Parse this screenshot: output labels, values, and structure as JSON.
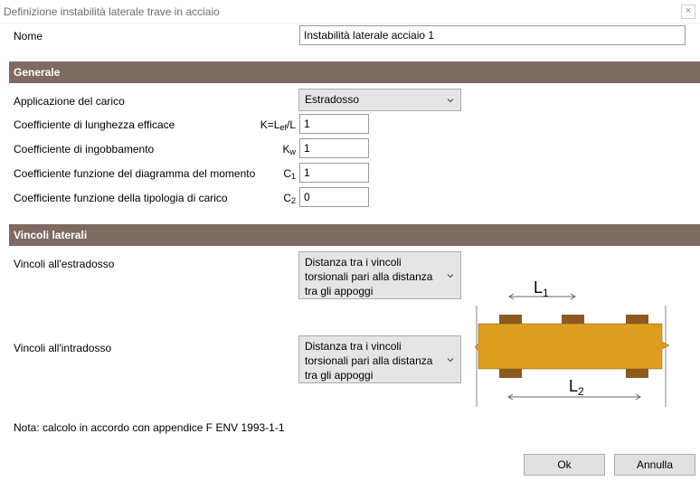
{
  "window": {
    "title": "Definizione instabilità laterale trave in acciaio",
    "close_glyph": "×"
  },
  "name_row": {
    "label": "Nome",
    "value": "Instabilità laterale acciaio 1"
  },
  "sections": {
    "general": "Generale",
    "lateral": "Vincoli laterali"
  },
  "general": {
    "load_application": {
      "label": "Applicazione del carico",
      "value": "Estradosso"
    },
    "k": {
      "label": "Coefficiente di lunghezza efficace",
      "symbol_main": "K=L",
      "symbol_sub": "ef",
      "symbol_tail": "/L",
      "value": "1"
    },
    "kw": {
      "label": "Coefficiente di ingobbamento",
      "symbol_main": "K",
      "symbol_sub": "w",
      "value": "1"
    },
    "c1": {
      "label": "Coefficiente funzione del diagramma del momento",
      "symbol_main": "C",
      "symbol_sub": "1",
      "value": "1"
    },
    "c2": {
      "label": "Coefficiente funzione della tipologia di carico",
      "symbol_main": "C",
      "symbol_sub": "2",
      "value": "0"
    }
  },
  "lateral": {
    "top": {
      "label": "Vincoli all'estradosso",
      "value_lines": [
        "Distanza tra i vincoli",
        "torsionali pari alla distanza",
        "tra gli appoggi"
      ]
    },
    "bottom": {
      "label": "Vincoli all'intradosso",
      "value_lines": [
        "Distanza tra i vincoli",
        "torsionali pari alla distanza",
        "tra gli appoggi"
      ]
    }
  },
  "diagram": {
    "l1_main": "L",
    "l1_sub": "1",
    "l2_main": "L",
    "l2_sub": "2",
    "beam_color": "#dd9e20",
    "restraint_color": "#8b5a1e"
  },
  "note": "Nota: calcolo in accordo con appendice F ENV 1993-1-1",
  "buttons": {
    "ok": "Ok",
    "cancel": "Annulla"
  },
  "colors": {
    "section_header": "#7d6b63",
    "control_bg": "#e5e5e5"
  }
}
